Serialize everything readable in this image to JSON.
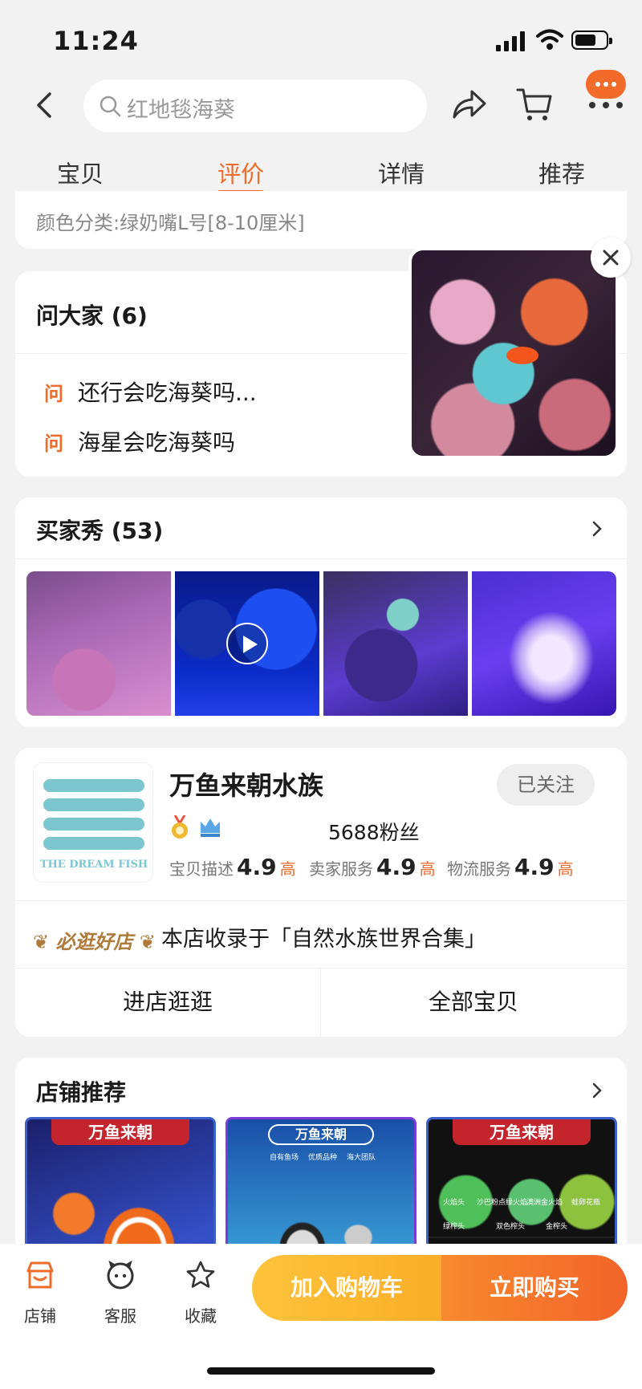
{
  "status_bar": {
    "time": "11:24"
  },
  "nav": {
    "search_placeholder": "红地毯海葵"
  },
  "tabs": [
    "宝贝",
    "评价",
    "详情",
    "推荐"
  ],
  "variant": {
    "text": "颜色分类:绿奶嘴L号[8-10厘米]"
  },
  "ask": {
    "title": "问大家 (6)",
    "q_label": "问",
    "questions": [
      "还行会吃海葵吗...",
      "海星会吃海葵吗"
    ]
  },
  "buyer_show": {
    "title": "买家秀 (53)"
  },
  "shop": {
    "logo_text": "THE DREAM FISH",
    "name": "万鱼来朝水族",
    "follow_label": "已关注",
    "fans": "5688粉丝",
    "scores": [
      {
        "label": "宝贝描述",
        "value": "4.9",
        "level": "高"
      },
      {
        "label": "卖家服务",
        "value": "4.9",
        "level": "高"
      },
      {
        "label": "物流服务",
        "value": "4.9",
        "level": "高"
      }
    ],
    "badge": "必逛好店",
    "badge_text": "本店收录于「自然水族世界合集」",
    "enter_label": "进店逛逛",
    "all_items_label": "全部宝贝"
  },
  "recommend": {
    "title": "店铺推荐",
    "banners": [
      "万鱼来朝",
      "万鱼来朝",
      "万鱼来朝"
    ],
    "r2_tags": [
      "自有鱼场",
      "优质品种",
      "海大团队"
    ],
    "r3_labels": [
      "火焰头",
      "沙巴粉点绿火焰",
      "澳洲金火焰",
      "蛙卵花瓶",
      "绿榨头",
      "双色榨头",
      "金榨头"
    ]
  },
  "bottom": {
    "store": "店铺",
    "service": "客服",
    "favorite": "收藏",
    "add_cart": "加入购物车",
    "buy_now": "立即购买"
  },
  "colors": {
    "accent": "#ee6b2a",
    "cart_btn": "#fbb52e",
    "buy_btn": "#f2642a"
  }
}
